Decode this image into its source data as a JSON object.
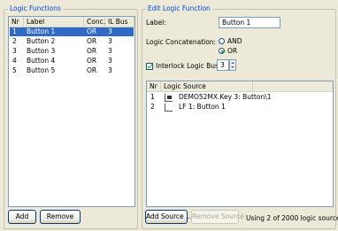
{
  "logic_functions": {
    "group_title": "Logic Functions",
    "columns": [
      "Nr",
      "Label",
      "Conc.",
      "IL Bus"
    ],
    "rows": [
      {
        "nr": "1",
        "label": "Button 1",
        "conc": "OR",
        "il_bus": "3",
        "selected": true
      },
      {
        "nr": "2",
        "label": "Button 2",
        "conc": "OR",
        "il_bus": "3",
        "selected": false
      },
      {
        "nr": "3",
        "label": "Button 3",
        "conc": "OR",
        "il_bus": "3",
        "selected": false
      },
      {
        "nr": "4",
        "label": "Button 4",
        "conc": "OR",
        "il_bus": "3",
        "selected": false
      },
      {
        "nr": "5",
        "label": "Button 5",
        "conc": "OR",
        "il_bus": "3",
        "selected": false
      }
    ],
    "add_label": "Add",
    "remove_label": "Remove"
  },
  "edit": {
    "group_title": "Edit Logic Function",
    "label_caption": "Label:",
    "label_value": "Button 1",
    "concat_caption": "Logic Concatenation:",
    "and_label": "AND",
    "or_label": "OR",
    "selected_concat": "OR",
    "interlock_label": "Interlock Logic Bus Nr:",
    "interlock_checked": true,
    "interlock_value": "3",
    "sources_columns": [
      "Nr",
      "Logic Source"
    ],
    "sources": [
      {
        "nr": "1",
        "text": "DEMO52MX.Key 3: Button\\1",
        "icon": "key-source-icon"
      },
      {
        "nr": "2",
        "text": "LF 1: Button 1",
        "icon": "logic-function-source-icon"
      }
    ],
    "add_source_label": "Add Source ...",
    "remove_source_label": "Remove Source",
    "status": "Using 2 of 2000 logic sources"
  },
  "colors": {
    "accent": "#0046d5",
    "selection": "#316ac5",
    "window_bg": "#ece9d8"
  }
}
